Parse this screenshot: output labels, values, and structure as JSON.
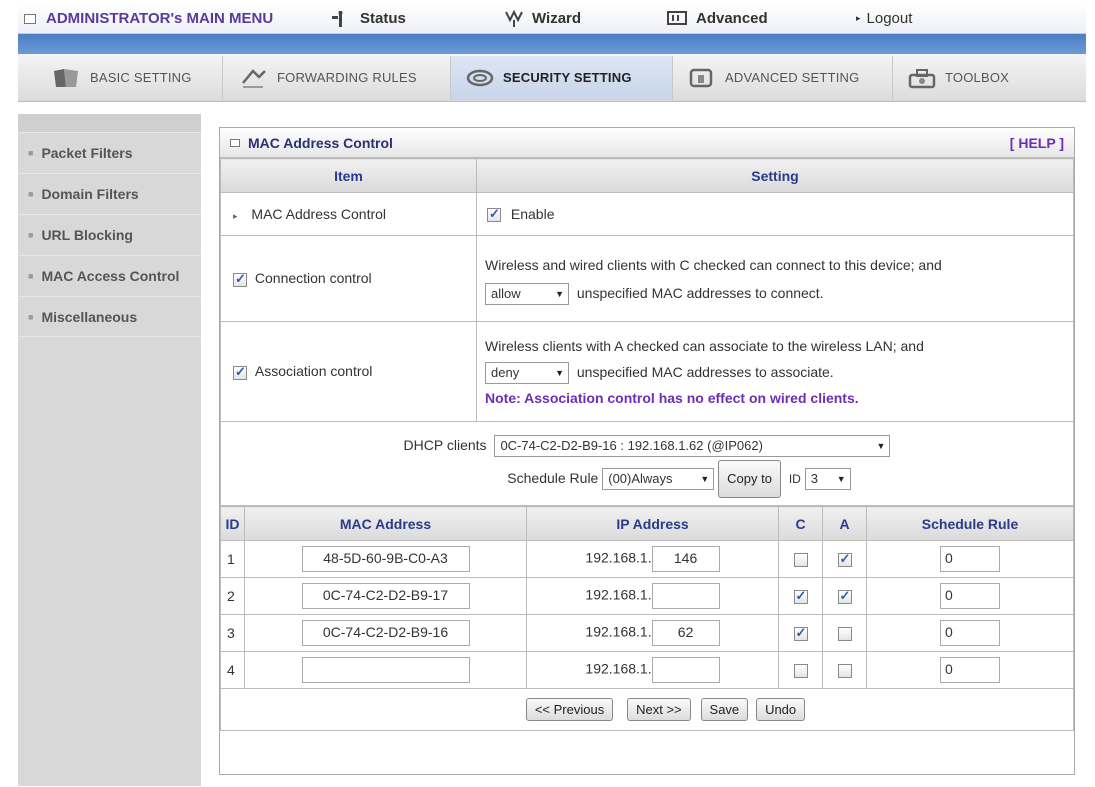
{
  "topmenu": {
    "admin": "ADMINISTRATOR's MAIN MENU",
    "status": "Status",
    "wizard": "Wizard",
    "advanced": "Advanced",
    "logout": "Logout"
  },
  "tabs": [
    {
      "label": "BASIC SETTING"
    },
    {
      "label": "FORWARDING RULES"
    },
    {
      "label": "SECURITY SETTING"
    },
    {
      "label": "ADVANCED SETTING"
    },
    {
      "label": "TOOLBOX"
    }
  ],
  "sidebar": {
    "items": [
      {
        "label": "Packet Filters"
      },
      {
        "label": "Domain Filters"
      },
      {
        "label": "URL Blocking"
      },
      {
        "label": "MAC Access Control"
      },
      {
        "label": "Miscellaneous"
      }
    ]
  },
  "panel": {
    "title": "MAC Address Control",
    "help": "[ HELP ]",
    "col_item": "Item",
    "col_setting": "Setting",
    "mac_control": {
      "label": "MAC Address Control",
      "enable_label": "Enable",
      "enabled": true
    },
    "connection": {
      "label": "Connection control",
      "checked": true,
      "text1": "Wireless and wired clients with C checked can connect to this device; and",
      "select": "allow",
      "text2": "unspecified MAC addresses to connect."
    },
    "association": {
      "label": "Association control",
      "checked": true,
      "text1": "Wireless clients with A checked can associate to the wireless LAN; and",
      "select": "deny",
      "text2": "unspecified MAC addresses to associate.",
      "note": "Note: Association control has no effect on wired clients."
    },
    "dhcp": {
      "label": "DHCP clients",
      "value": "0C-74-C2-D2-B9-16 : 192.168.1.62 (@IP062)",
      "schedule_label": "Schedule Rule",
      "schedule_value": "(00)Always",
      "copy_to": "Copy to",
      "id_label": "ID",
      "id_value": "3"
    },
    "list_headers": {
      "id": "ID",
      "mac": "MAC Address",
      "ip": "IP Address",
      "c": "C",
      "a": "A",
      "schedule": "Schedule Rule"
    },
    "rows": [
      {
        "id": "1",
        "mac": "48-5D-60-9B-C0-A3",
        "ip_prefix": "192.168.1.",
        "ip_last": "146",
        "c": false,
        "a": true,
        "schedule": "0"
      },
      {
        "id": "2",
        "mac": "0C-74-C2-D2-B9-17",
        "ip_prefix": "192.168.1.",
        "ip_last": "",
        "c": true,
        "a": true,
        "schedule": "0"
      },
      {
        "id": "3",
        "mac": "0C-74-C2-D2-B9-16",
        "ip_prefix": "192.168.1.",
        "ip_last": "62",
        "c": true,
        "a": false,
        "schedule": "0"
      },
      {
        "id": "4",
        "mac": "",
        "ip_prefix": "192.168.1.",
        "ip_last": "",
        "c": false,
        "a": false,
        "schedule": "0"
      }
    ],
    "buttons": {
      "previous": "<< Previous",
      "next": "Next >>",
      "save": "Save",
      "undo": "Undo"
    }
  }
}
